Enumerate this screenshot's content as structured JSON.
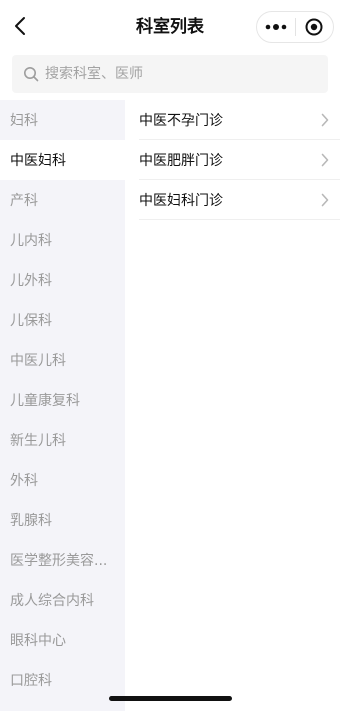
{
  "header": {
    "title": "科室列表",
    "back_icon": "chevron-left-icon",
    "more_icon": "more-dots-icon",
    "close_icon": "target-circle-icon"
  },
  "search": {
    "placeholder": "搜索科室、医师",
    "icon": "search-icon"
  },
  "sidebar": {
    "active_index": 1,
    "items": [
      {
        "label": "妇科"
      },
      {
        "label": "中医妇科"
      },
      {
        "label": "产科"
      },
      {
        "label": "儿内科"
      },
      {
        "label": "儿外科"
      },
      {
        "label": "儿保科"
      },
      {
        "label": "中医儿科"
      },
      {
        "label": "儿童康复科"
      },
      {
        "label": "新生儿科"
      },
      {
        "label": "外科"
      },
      {
        "label": "乳腺科"
      },
      {
        "label": "医学整形美容..."
      },
      {
        "label": "成人综合内科"
      },
      {
        "label": "眼科中心"
      },
      {
        "label": "口腔科"
      }
    ]
  },
  "clinics": [
    {
      "label": "中医不孕门诊"
    },
    {
      "label": "中医肥胖门诊"
    },
    {
      "label": "中医妇科门诊"
    }
  ],
  "colors": {
    "sidebar_bg": "#f4f4f9",
    "text_primary": "#111111",
    "text_muted": "#9a9a9a"
  }
}
